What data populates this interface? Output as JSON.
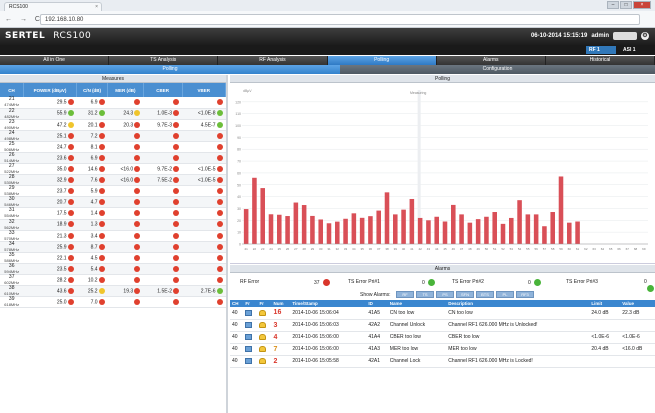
{
  "browser": {
    "tab_title": "RCS100",
    "url": "192.168.10.80",
    "nav": "← → C",
    "tab_close": "×",
    "win_min": "–",
    "win_max": "□",
    "win_close": "×"
  },
  "app": {
    "brand": "SERTEL",
    "model": "RCS100",
    "datetime": "06-10-2014 15:15:19",
    "user": "admin",
    "rf": "RF 1",
    "asi": "ASI 1",
    "settings_icon": "gear-icon",
    "help_icon": "info-icon"
  },
  "menu": [
    "All in One",
    "TS Analysis",
    "RF Analysis",
    "Polling",
    "Alarms",
    "Historical"
  ],
  "menu_active": "Polling",
  "submenu": {
    "polling": "Polling",
    "configuration": "Configuration"
  },
  "measures": {
    "title": "Measures",
    "columns": [
      "CH",
      "POWER (dBµV)",
      "C/N (dB)",
      "MER (dB)",
      "CBER",
      "VBER"
    ],
    "rows": [
      {
        "ch": "21",
        "freq": "474MHz",
        "power": "29.5",
        "ps": "r",
        "cn": "6.9",
        "cs": "r",
        "mer": "",
        "ms": "r",
        "cber": "",
        "cbs": "r",
        "vber": "",
        "vs": "r"
      },
      {
        "ch": "22",
        "freq": "482MHz",
        "power": "55.9",
        "ps": "g",
        "cn": "31.2",
        "cs": "g",
        "mer": "24.3",
        "ms": "y",
        "cber": "1.0E-3",
        "cbs": "r",
        "vber": "<1.0E-8",
        "vs": "g"
      },
      {
        "ch": "23",
        "freq": "490MHz",
        "power": "47.2",
        "ps": "y",
        "cn": "20.1",
        "cs": "r",
        "mer": "20.3",
        "ms": "r",
        "cber": "9.7E-3",
        "cbs": "r",
        "vber": "4.5E-7",
        "vs": "g"
      },
      {
        "ch": "24",
        "freq": "498MHz",
        "power": "25.1",
        "ps": "r",
        "cn": "7.2",
        "cs": "r",
        "mer": "",
        "ms": "r",
        "cber": "",
        "cbs": "r",
        "vber": "",
        "vs": "r"
      },
      {
        "ch": "25",
        "freq": "506MHz",
        "power": "24.7",
        "ps": "r",
        "cn": "8.1",
        "cs": "r",
        "mer": "",
        "ms": "r",
        "cber": "",
        "cbs": "r",
        "vber": "",
        "vs": "r"
      },
      {
        "ch": "26",
        "freq": "514MHz",
        "power": "23.6",
        "ps": "r",
        "cn": "6.9",
        "cs": "r",
        "mer": "",
        "ms": "r",
        "cber": "",
        "cbs": "r",
        "vber": "",
        "vs": "r"
      },
      {
        "ch": "27",
        "freq": "522MHz",
        "power": "35.0",
        "ps": "r",
        "cn": "14.6",
        "cs": "r",
        "mer": "<16.0",
        "ms": "r",
        "cber": "9.7E-2",
        "cbs": "r",
        "vber": "<1.0E-5",
        "vs": "r"
      },
      {
        "ch": "28",
        "freq": "530MHz",
        "power": "32.9",
        "ps": "r",
        "cn": "7.6",
        "cs": "r",
        "mer": "<16.0",
        "ms": "r",
        "cber": "7.5E-2",
        "cbs": "r",
        "vber": "<1.0E-5",
        "vs": "r"
      },
      {
        "ch": "29",
        "freq": "538MHz",
        "power": "23.7",
        "ps": "r",
        "cn": "5.9",
        "cs": "r",
        "mer": "",
        "ms": "r",
        "cber": "",
        "cbs": "r",
        "vber": "",
        "vs": "r"
      },
      {
        "ch": "30",
        "freq": "546MHz",
        "power": "20.7",
        "ps": "r",
        "cn": "4.7",
        "cs": "r",
        "mer": "",
        "ms": "r",
        "cber": "",
        "cbs": "r",
        "vber": "",
        "vs": "r"
      },
      {
        "ch": "31",
        "freq": "554MHz",
        "power": "17.5",
        "ps": "r",
        "cn": "1.4",
        "cs": "r",
        "mer": "",
        "ms": "r",
        "cber": "",
        "cbs": "r",
        "vber": "",
        "vs": "r"
      },
      {
        "ch": "32",
        "freq": "562MHz",
        "power": "18.9",
        "ps": "r",
        "cn": "1.3",
        "cs": "r",
        "mer": "",
        "ms": "r",
        "cber": "",
        "cbs": "r",
        "vber": "",
        "vs": "r"
      },
      {
        "ch": "33",
        "freq": "570MHz",
        "power": "21.3",
        "ps": "r",
        "cn": "3.4",
        "cs": "r",
        "mer": "",
        "ms": "r",
        "cber": "",
        "cbs": "r",
        "vber": "",
        "vs": "r"
      },
      {
        "ch": "34",
        "freq": "578MHz",
        "power": "25.9",
        "ps": "r",
        "cn": "8.7",
        "cs": "r",
        "mer": "",
        "ms": "r",
        "cber": "",
        "cbs": "r",
        "vber": "",
        "vs": "r"
      },
      {
        "ch": "35",
        "freq": "586MHz",
        "power": "22.1",
        "ps": "r",
        "cn": "4.5",
        "cs": "r",
        "mer": "",
        "ms": "r",
        "cber": "",
        "cbs": "r",
        "vber": "",
        "vs": "r"
      },
      {
        "ch": "36",
        "freq": "594MHz",
        "power": "23.5",
        "ps": "r",
        "cn": "5.4",
        "cs": "r",
        "mer": "",
        "ms": "r",
        "cber": "",
        "cbs": "r",
        "vber": "",
        "vs": "r"
      },
      {
        "ch": "37",
        "freq": "602MHz",
        "power": "28.2",
        "ps": "r",
        "cn": "10.2",
        "cs": "r",
        "mer": "",
        "ms": "r",
        "cber": "",
        "cbs": "r",
        "vber": "",
        "vs": "r"
      },
      {
        "ch": "38",
        "freq": "610MHz",
        "power": "43.6",
        "ps": "r",
        "cn": "25.2",
        "cs": "y",
        "mer": "19.3",
        "ms": "r",
        "cber": "1.5E-2",
        "cbs": "r",
        "vber": "2.7E-6",
        "vs": "g"
      },
      {
        "ch": "39",
        "freq": "618MHz",
        "power": "25.0",
        "ps": "r",
        "cn": "7.0",
        "cs": "r",
        "mer": "",
        "ms": "r",
        "cber": "",
        "cbs": "r",
        "vber": "",
        "vs": "r"
      }
    ]
  },
  "polling_panel": {
    "title": "Polling",
    "y_unit": "dBµV",
    "marker_label": "Measuring"
  },
  "chart_data": {
    "type": "bar",
    "ylim": [
      0,
      130
    ],
    "yticks": [
      0,
      10,
      20,
      30,
      40,
      50,
      60,
      70,
      80,
      90,
      100,
      110,
      120
    ],
    "categories": [
      "21",
      "22",
      "23",
      "24",
      "25",
      "26",
      "27",
      "28",
      "29",
      "30",
      "31",
      "32",
      "33",
      "34",
      "35",
      "36",
      "37",
      "38",
      "39",
      "40",
      "41",
      "42",
      "43",
      "44",
      "45",
      "46",
      "47",
      "48",
      "49",
      "50",
      "51",
      "52",
      "53",
      "54",
      "55",
      "56",
      "57",
      "58",
      "59",
      "60",
      "61",
      "62",
      "63",
      "64",
      "65",
      "66",
      "67",
      "68",
      "69"
    ],
    "values": [
      29.5,
      55.9,
      47.2,
      25.1,
      24.7,
      23.6,
      35.0,
      32.9,
      23.7,
      20.7,
      17.5,
      18.9,
      21.3,
      25.9,
      22.1,
      23.5,
      28.2,
      43.6,
      25.0,
      29,
      38,
      22,
      20,
      23,
      19,
      33,
      25,
      18,
      21,
      23,
      27,
      17,
      22,
      37,
      25,
      25,
      15,
      27,
      57,
      18,
      19,
      0,
      0,
      0,
      0,
      0,
      0,
      0,
      0
    ],
    "marker_category": "42",
    "color": "#d94f57"
  },
  "alarms": {
    "title": "Alarms",
    "counters": [
      {
        "label": "RF Error",
        "value": "37",
        "color": "#d9362b"
      },
      {
        "label": "TS Error Pri#1",
        "value": "0",
        "color": "#49b43a"
      },
      {
        "label": "TS Error Pri#2",
        "value": "0",
        "color": "#49b43a"
      },
      {
        "label": "TS Error Pri#3",
        "value": "0",
        "color": "#49b43a"
      }
    ],
    "show_label": "Show Alarms:",
    "filters": [
      "RF",
      "TS",
      "PS",
      "SFN",
      "BTS",
      "PL",
      "RF3"
    ],
    "columns": [
      "CH",
      "Fr",
      "Fr",
      "Num",
      "Time/Stamp",
      "ID",
      "Name",
      "Description",
      "Limit",
      "Value"
    ],
    "rows": [
      {
        "ch": "40",
        "num": "16",
        "time": "2014-10-06 15:06:04",
        "id": "41A5",
        "name": "CN too low",
        "desc": "CN too low",
        "limit": "24.0 dB",
        "value": "22.3 dB",
        "c": "r"
      },
      {
        "ch": "40",
        "num": "3",
        "time": "2014-10-06 15:06:03",
        "id": "42A2",
        "name": "Channel Unlock",
        "desc": "Channel RF1 626.000 MHz is Unlocked!",
        "limit": "",
        "value": "",
        "c": "r"
      },
      {
        "ch": "40",
        "num": "4",
        "time": "2014-10-06 15:06:00",
        "id": "41A4",
        "name": "CBER too low",
        "desc": "CBER too low",
        "limit": "<1.0E-6",
        "value": "<1.0E-6",
        "c": "r"
      },
      {
        "ch": "40",
        "num": "7",
        "time": "2014-10-06 15:06:00",
        "id": "41A3",
        "name": "MER too low",
        "desc": "MER too low",
        "limit": "20.4 dB",
        "value": "<16.0 dB",
        "c": "y"
      },
      {
        "ch": "40",
        "num": "2",
        "time": "2014-10-06 15:05:58",
        "id": "42A1",
        "name": "Channel Lock",
        "desc": "Channel RF1 626.000 MHz is Locked!",
        "limit": "",
        "value": "",
        "c": "r"
      }
    ]
  }
}
